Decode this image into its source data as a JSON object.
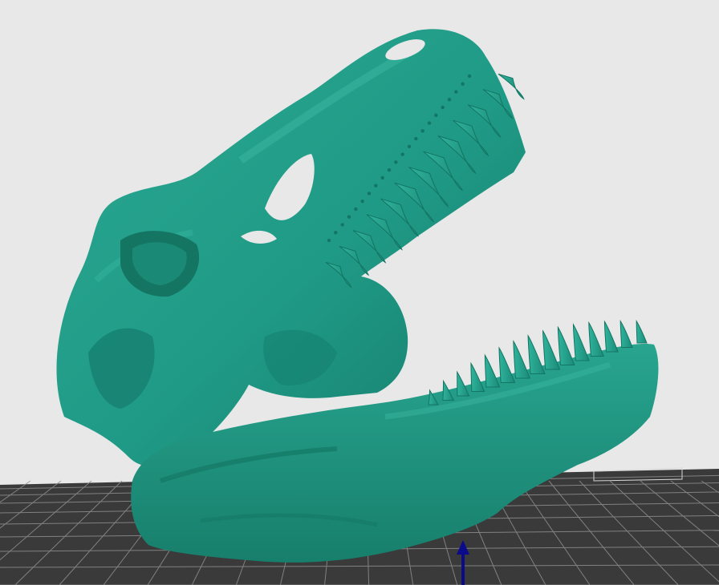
{
  "viewport": {
    "background_color": "#e8e8e8",
    "build_plate_color": "#3a3a3a",
    "grid_line_color": "#9a9a9a",
    "model_color": "#1f9a86",
    "model_shadow_color": "#137563",
    "model_highlight_color": "#3bb8a2",
    "axis_arrow_color": "#0a0a8a"
  },
  "model": {
    "icon": "trex-skull-model"
  },
  "axis": {
    "icon": "z-axis-arrow-icon"
  }
}
